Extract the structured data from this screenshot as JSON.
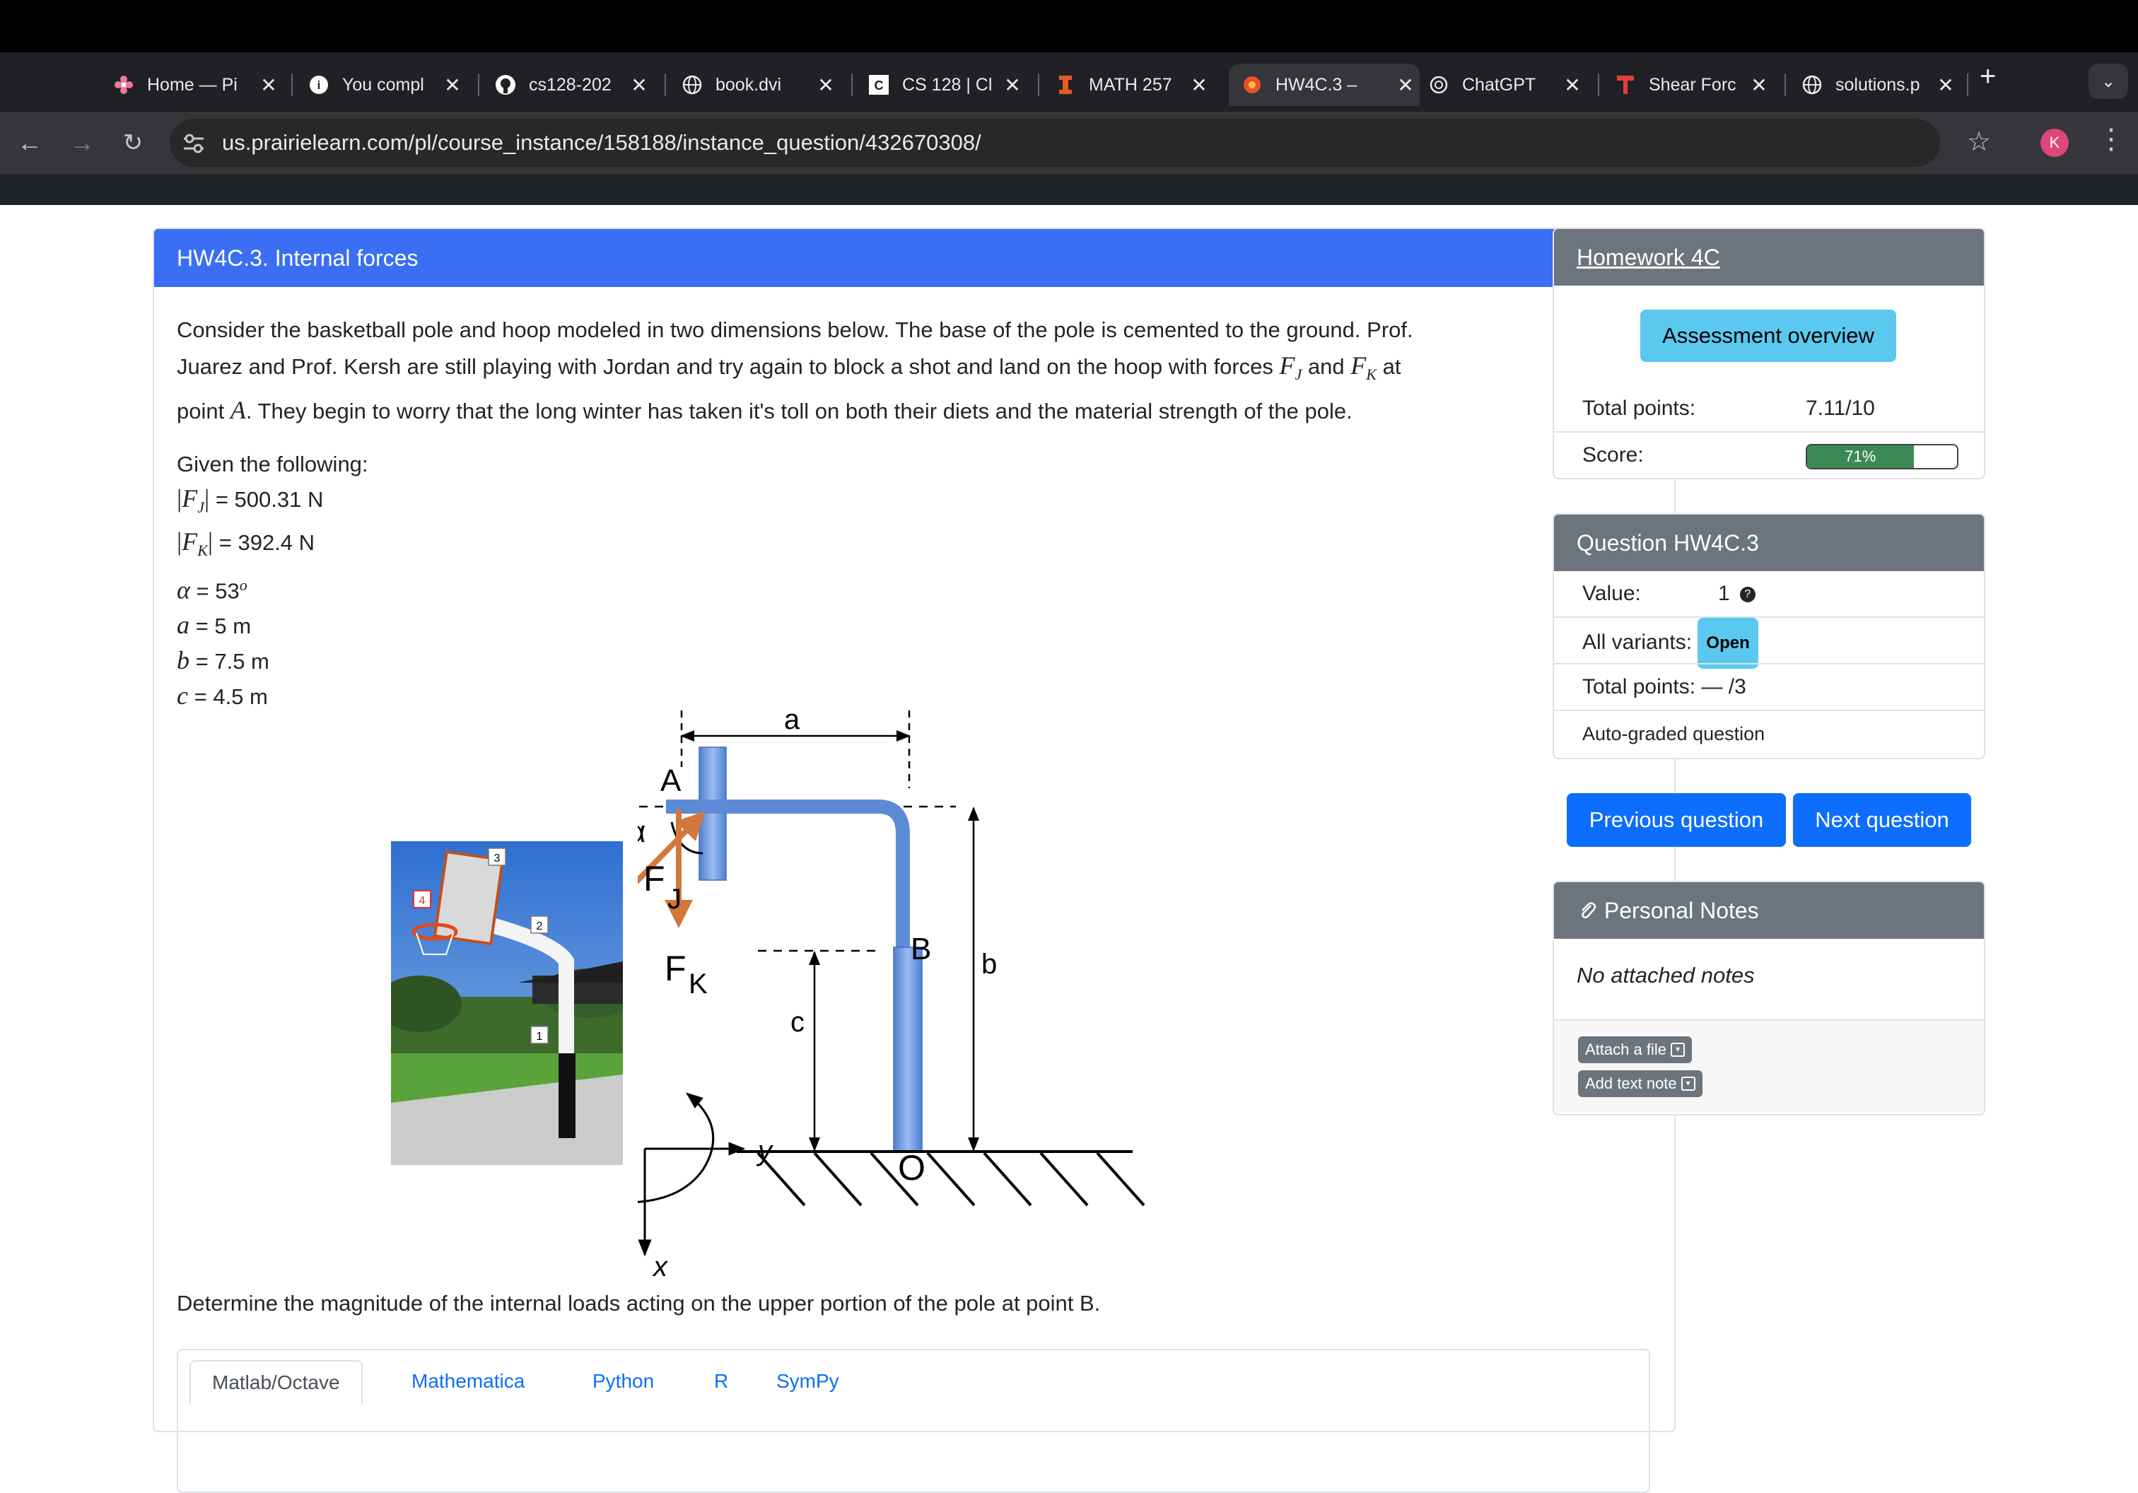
{
  "browser": {
    "tabs": [
      {
        "title": "Home — Pi",
        "icon": "flower-icon"
      },
      {
        "title": "You compl",
        "icon": "info-icon"
      },
      {
        "title": "cs128-202",
        "icon": "github-icon"
      },
      {
        "title": "book.dvi",
        "icon": "globe-icon"
      },
      {
        "title": "CS 128 | Cl",
        "icon": "cs-icon"
      },
      {
        "title": "MATH 257",
        "icon": "illinois-icon"
      },
      {
        "title": "HW4C.3 –",
        "icon": "prairielearn-icon"
      },
      {
        "title": "ChatGPT",
        "icon": "openai-icon"
      },
      {
        "title": "Shear Forc",
        "icon": "t-logo-icon"
      },
      {
        "title": "solutions.p",
        "icon": "globe-icon"
      }
    ],
    "active_tab": 6,
    "url": "us.prairielearn.com/pl/course_instance/158188/instance_question/432670308/",
    "avatar_letter": "K"
  },
  "question": {
    "title": "HW4C.3. Internal forces",
    "para_1": "Consider the basketball pole and hoop modeled in two dimensions below. The base of the pole is cemented to the ground. Prof.",
    "para_2a": "Juarez and Prof. Kersh are still playing with Jordan and try again to block a shot and land on the hoop with forces",
    "para_2b": "and",
    "para_2c": "at",
    "para_3a": "point",
    "para_3b": ". They begin to worry that the long winter has taken it's toll on both their diets and the material strength of the pole.",
    "given_label": "Given the following:",
    "fj_value": "= 500.31 N",
    "fk_value": "= 392.4 N",
    "alpha_value": "= 53",
    "a_value": "= 5 m",
    "b_value": "= 7.5 m",
    "c_value": "= 4.5 m",
    "determine": "Determine the magnitude of the internal loads acting on the upper portion of the pole at point B.",
    "lang_tabs": [
      "Matlab/Octave",
      "Mathematica",
      "Python",
      "R",
      "SymPy"
    ]
  },
  "photo_labels": [
    "1",
    "2",
    "3",
    "4"
  ],
  "diagram_labels": {
    "a": "a",
    "A": "A",
    "alpha": "α",
    "FJ": "F",
    "FJ_sub": "J",
    "FK": "F",
    "FK_sub": "K",
    "B": "B",
    "b": "b",
    "c": "c",
    "O": "O",
    "y": "y",
    "x": "x"
  },
  "sidebar": {
    "homework_title": "Homework 4C",
    "assessment_overview": "Assessment overview",
    "total_points_label": "Total points:",
    "total_points_value": "7.11/10",
    "score_label": "Score:",
    "score_percent": 71,
    "score_text": "71%",
    "question_title": "Question HW4C.3",
    "value_label": "Value:",
    "value_value": "1",
    "all_variants_label": "All variants:",
    "all_variants_badge": "Open",
    "q_total_points_label": "Total points:",
    "q_total_points_value": "— /3",
    "auto_graded": "Auto-graded question",
    "prev_button": "Previous question",
    "next_button": "Next question",
    "notes_title": "Personal Notes",
    "no_notes": "No attached notes",
    "attach_file": "Attach a file",
    "add_text_note": "Add text note"
  },
  "colors": {
    "header_blue": "#3a6ff3",
    "primary": "#0d6efd",
    "info": "#5bc8ef",
    "secondary": "#6c757d",
    "force_orange": "#d4773a",
    "pole_blue": "#5d8ad6",
    "progress_green": "#3b8a55"
  }
}
